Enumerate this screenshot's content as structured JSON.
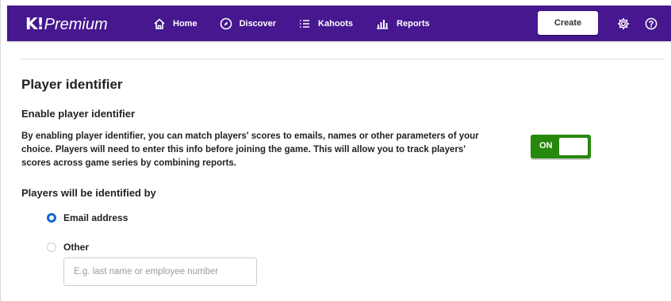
{
  "header": {
    "brand_mark": "K!",
    "brand_name": "Premium",
    "nav": [
      {
        "label": "Home",
        "icon": "home-icon"
      },
      {
        "label": "Discover",
        "icon": "compass-icon"
      },
      {
        "label": "Kahoots",
        "icon": "list-icon"
      },
      {
        "label": "Reports",
        "icon": "bar-chart-icon"
      }
    ],
    "create_label": "Create",
    "settings_icon": "gear-icon",
    "help_icon": "question-icon",
    "bar_color": "#46178f"
  },
  "settings": {
    "section_title": "Player identifier",
    "enable_title": "Enable player identifier",
    "description": "By enabling player identifier, you can match players' scores to emails, names or other parameters of your choice. Players will need to enter this info before joining the game. This will allow you to track players' scores across game series by combining reports.",
    "toggle": {
      "label": "ON",
      "state": true,
      "color": "#26890c"
    },
    "identified_by_title": "Players will be identified by",
    "options": [
      {
        "label": "Email address",
        "selected": true
      },
      {
        "label": "Other",
        "selected": false
      }
    ],
    "other_input": {
      "value": "",
      "placeholder": "E.g. last name or employee number"
    }
  }
}
